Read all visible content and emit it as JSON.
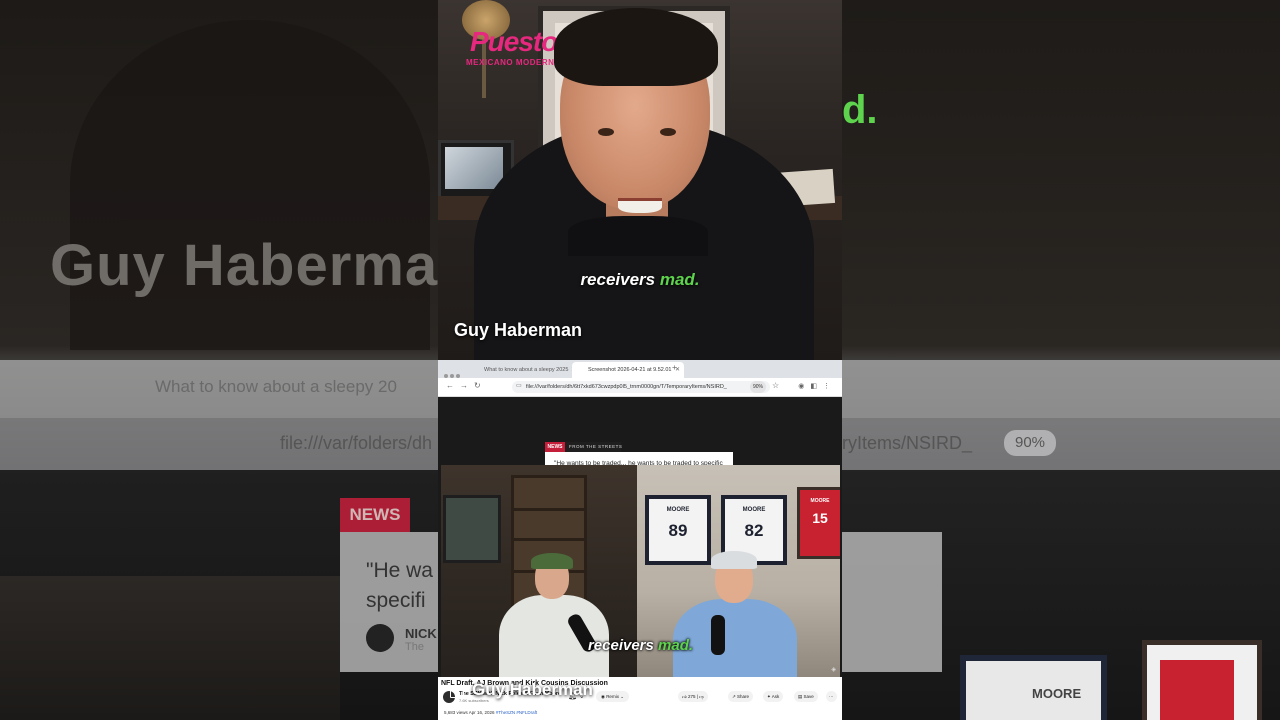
{
  "logo": {
    "brand": "Puesto",
    "tagline": "MEXICANO MODERNO"
  },
  "top_clip": {
    "caption_white": "receivers",
    "caption_green": "mad.",
    "speaker_name": "Guy Haberman"
  },
  "browser": {
    "tab1_title": "What to know about a sleepy 2025",
    "tab2_title": "Screenshot 2026-04-21 at 9.52.01",
    "url": "file:///var/folders/dh/6tt7xkd673cwzpdp0l5_trnm0000gn/T/TemporaryItems/NSIRD_",
    "zoom": "90%"
  },
  "overlay": {
    "news_tag": "NEWS",
    "section": "FROM THE STREETS",
    "quote": "\"He wants to be traded... he wants to be traded to specific places\"",
    "source": "NICK FOLES ON AJ BROWN TRADE",
    "source_sub": "The SZN Pod"
  },
  "jerseys": [
    {
      "name": "MOORE",
      "number": "89"
    },
    {
      "name": "MOORE",
      "number": "82"
    },
    {
      "name": "MOORE",
      "number": "15"
    }
  ],
  "video_caption": {
    "white": "receivers",
    "green": "mad."
  },
  "youtube": {
    "title": "NFL Draft, AJ Brown and Kirk Cousins Discussion",
    "channel": "The SZN with Nick Foles & Evan Moore",
    "subscribers": "7.6K subscribers",
    "remix": "Remix",
    "likes": "275",
    "share": "Share",
    "ask": "Ask",
    "save": "Save",
    "views": "5,683 views Apr 16, 2026",
    "tags": "#TheSZN #NFLDraft"
  },
  "bottom_name": "Guy Haberman",
  "background": {
    "left_name": "Guy Haberma",
    "left_tab": "What to know about a sleepy 20",
    "left_url": "file:///var/folders/dh",
    "left_news": "NEWS",
    "left_quote_1": "\"He wa",
    "left_quote_2": "specifi",
    "left_nick": "NICK",
    "left_nick_sub": "The",
    "right_mad": "d.",
    "right_url": "ryItems/NSIRD_",
    "right_zoom": "90%",
    "right_moore": "MOORE"
  },
  "colors": {
    "accent_green": "#5ed34d",
    "news_red": "#c41f3a",
    "logo_pink": "#e6287e",
    "host_shirt": "#7fa8d8"
  }
}
